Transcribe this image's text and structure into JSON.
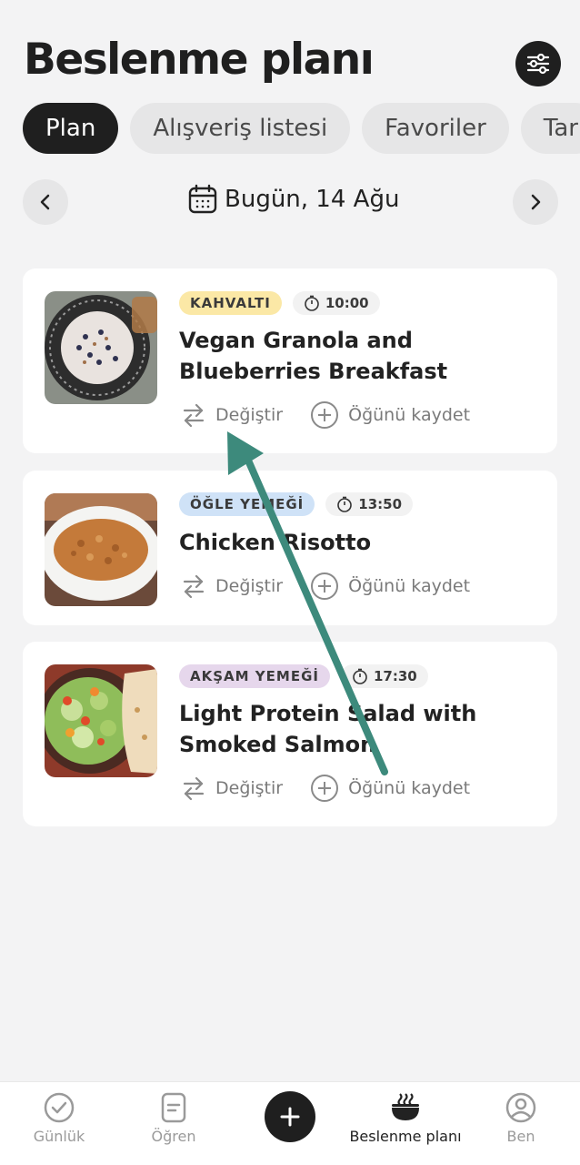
{
  "header": {
    "title": "Beslenme planı"
  },
  "tabs": [
    {
      "label": "Plan",
      "active": true
    },
    {
      "label": "Alışveriş listesi",
      "active": false
    },
    {
      "label": "Favoriler",
      "active": false
    },
    {
      "label": "Tar",
      "active": false
    }
  ],
  "date": {
    "label": "Bugün, 14 Ağu"
  },
  "meals": [
    {
      "type": "KAHVALTI",
      "type_color": "#fbe8a6",
      "time": "10:00",
      "title": "Vegan Granola and Blueberries Breakfast",
      "swap_label": "Değiştir",
      "save_label": "Öğünü kaydet"
    },
    {
      "type": "ÖĞLE YEMEĞİ",
      "type_color": "#cfe2f7",
      "time": "13:50",
      "title": "Chicken Risotto",
      "swap_label": "Değiştir",
      "save_label": "Öğünü kaydet"
    },
    {
      "type": "AKŞAM YEMEĞİ",
      "type_color": "#e6d7ec",
      "time": "17:30",
      "title": "Light Protein Salad with Smoked Salmon",
      "swap_label": "Değiştir",
      "save_label": "Öğünü kaydet"
    }
  ],
  "bottom_nav": [
    {
      "label": "Günlük",
      "icon": "check-circle-icon",
      "active": false
    },
    {
      "label": "Öğren",
      "icon": "document-icon",
      "active": false
    },
    {
      "label": "Beslenme planı",
      "icon": "bowl-icon",
      "active": true
    },
    {
      "label": "Ben",
      "icon": "user-circle-icon",
      "active": false
    }
  ],
  "colors": {
    "dark": "#1f1f1f",
    "annotation_arrow": "#3d8a7c",
    "background": "#f3f3f4"
  }
}
